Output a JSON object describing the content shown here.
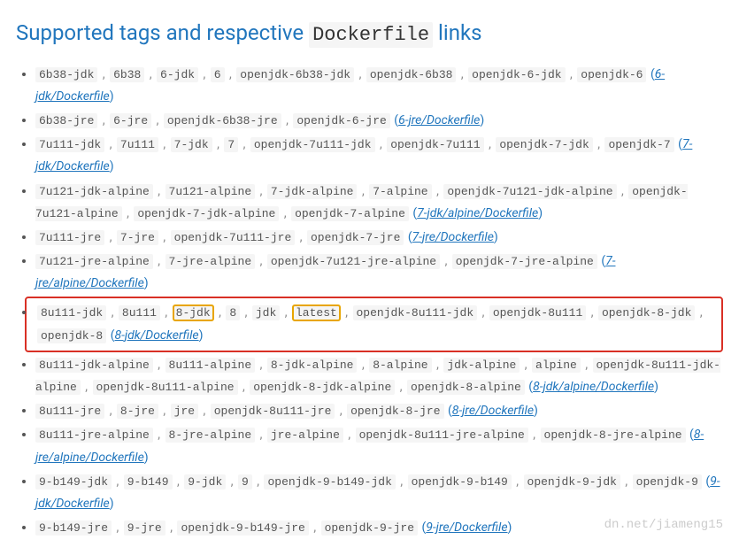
{
  "heading": {
    "pre": "Supported tags and respective ",
    "code": "Dockerfile",
    "post": " links"
  },
  "items": [
    {
      "tags": [
        "6b38-jdk",
        "6b38",
        "6-jdk",
        "6",
        "openjdk-6b38-jdk",
        "openjdk-6b38",
        "openjdk-6-jdk",
        "openjdk-6"
      ],
      "link": "6-jdk/Dockerfile"
    },
    {
      "tags": [
        "6b38-jre",
        "6-jre",
        "openjdk-6b38-jre",
        "openjdk-6-jre"
      ],
      "link": "6-jre/Dockerfile"
    },
    {
      "tags": [
        "7u111-jdk",
        "7u111",
        "7-jdk",
        "7",
        "openjdk-7u111-jdk",
        "openjdk-7u111",
        "openjdk-7-jdk",
        "openjdk-7"
      ],
      "link": "7-jdk/Dockerfile"
    },
    {
      "tags": [
        "7u121-jdk-alpine",
        "7u121-alpine",
        "7-jdk-alpine",
        "7-alpine",
        "openjdk-7u121-jdk-alpine",
        "openjdk-7u121-alpine",
        "openjdk-7-jdk-alpine",
        "openjdk-7-alpine"
      ],
      "link": "7-jdk/alpine/Dockerfile"
    },
    {
      "tags": [
        "7u111-jre",
        "7-jre",
        "openjdk-7u111-jre",
        "openjdk-7-jre"
      ],
      "link": "7-jre/Dockerfile"
    },
    {
      "tags": [
        "7u121-jre-alpine",
        "7-jre-alpine",
        "openjdk-7u121-jre-alpine",
        "openjdk-7-jre-alpine"
      ],
      "link": "7-jre/alpine/Dockerfile"
    },
    {
      "tags": [
        "8u111-jdk",
        "8u111",
        "8-jdk",
        "8",
        "jdk",
        "latest",
        "openjdk-8u111-jdk",
        "openjdk-8u111",
        "openjdk-8-jdk",
        "openjdk-8"
      ],
      "link": "8-jdk/Dockerfile",
      "red": true,
      "yellow": [
        "8-jdk",
        "latest"
      ]
    },
    {
      "tags": [
        "8u111-jdk-alpine",
        "8u111-alpine",
        "8-jdk-alpine",
        "8-alpine",
        "jdk-alpine",
        "alpine",
        "openjdk-8u111-jdk-alpine",
        "openjdk-8u111-alpine",
        "openjdk-8-jdk-alpine",
        "openjdk-8-alpine"
      ],
      "link": "8-jdk/alpine/Dockerfile"
    },
    {
      "tags": [
        "8u111-jre",
        "8-jre",
        "jre",
        "openjdk-8u111-jre",
        "openjdk-8-jre"
      ],
      "link": "8-jre/Dockerfile"
    },
    {
      "tags": [
        "8u111-jre-alpine",
        "8-jre-alpine",
        "jre-alpine",
        "openjdk-8u111-jre-alpine",
        "openjdk-8-jre-alpine"
      ],
      "link": "8-jre/alpine/Dockerfile"
    },
    {
      "tags": [
        "9-b149-jdk",
        "9-b149",
        "9-jdk",
        "9",
        "openjdk-9-b149-jdk",
        "openjdk-9-b149",
        "openjdk-9-jdk",
        "openjdk-9"
      ],
      "link": "9-jdk/Dockerfile"
    },
    {
      "tags": [
        "9-b149-jre",
        "9-jre",
        "openjdk-9-b149-jre",
        "openjdk-9-jre"
      ],
      "link": "9-jre/Dockerfile"
    }
  ],
  "watermark": "dn.net/jiameng15"
}
